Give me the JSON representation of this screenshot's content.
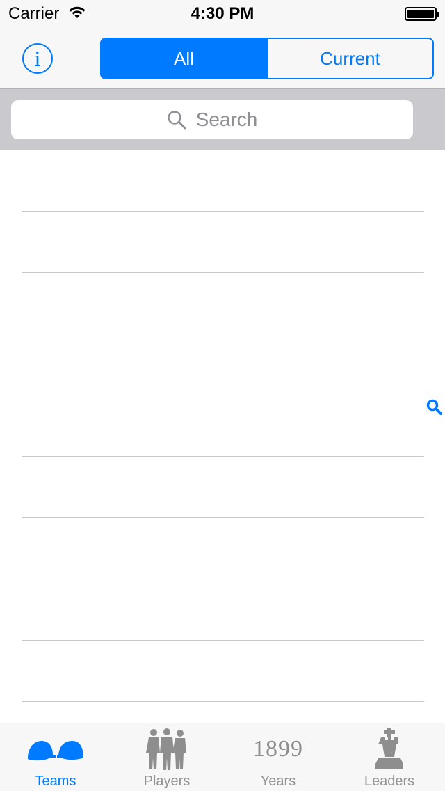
{
  "status_bar": {
    "carrier": "Carrier",
    "time": "4:30 PM"
  },
  "nav": {
    "info_icon_glyph": "i",
    "segments": [
      {
        "label": "All",
        "selected": true
      },
      {
        "label": "Current",
        "selected": false
      }
    ]
  },
  "search": {
    "placeholder": "Search"
  },
  "table": {
    "row_count": 9
  },
  "tabs": [
    {
      "label": "Teams",
      "icon": "caps-icon",
      "selected": true
    },
    {
      "label": "Players",
      "icon": "players-icon",
      "selected": false
    },
    {
      "label": "Years",
      "icon": "year-icon",
      "icon_text": "1899",
      "selected": false
    },
    {
      "label": "Leaders",
      "icon": "chess-king-icon",
      "selected": false
    }
  ],
  "colors": {
    "accent": "#007aff",
    "inactive": "#929292",
    "bar_background": "#f7f7f7",
    "search_bar_background": "#c9c9ce",
    "separator": "#c8c7cc"
  }
}
